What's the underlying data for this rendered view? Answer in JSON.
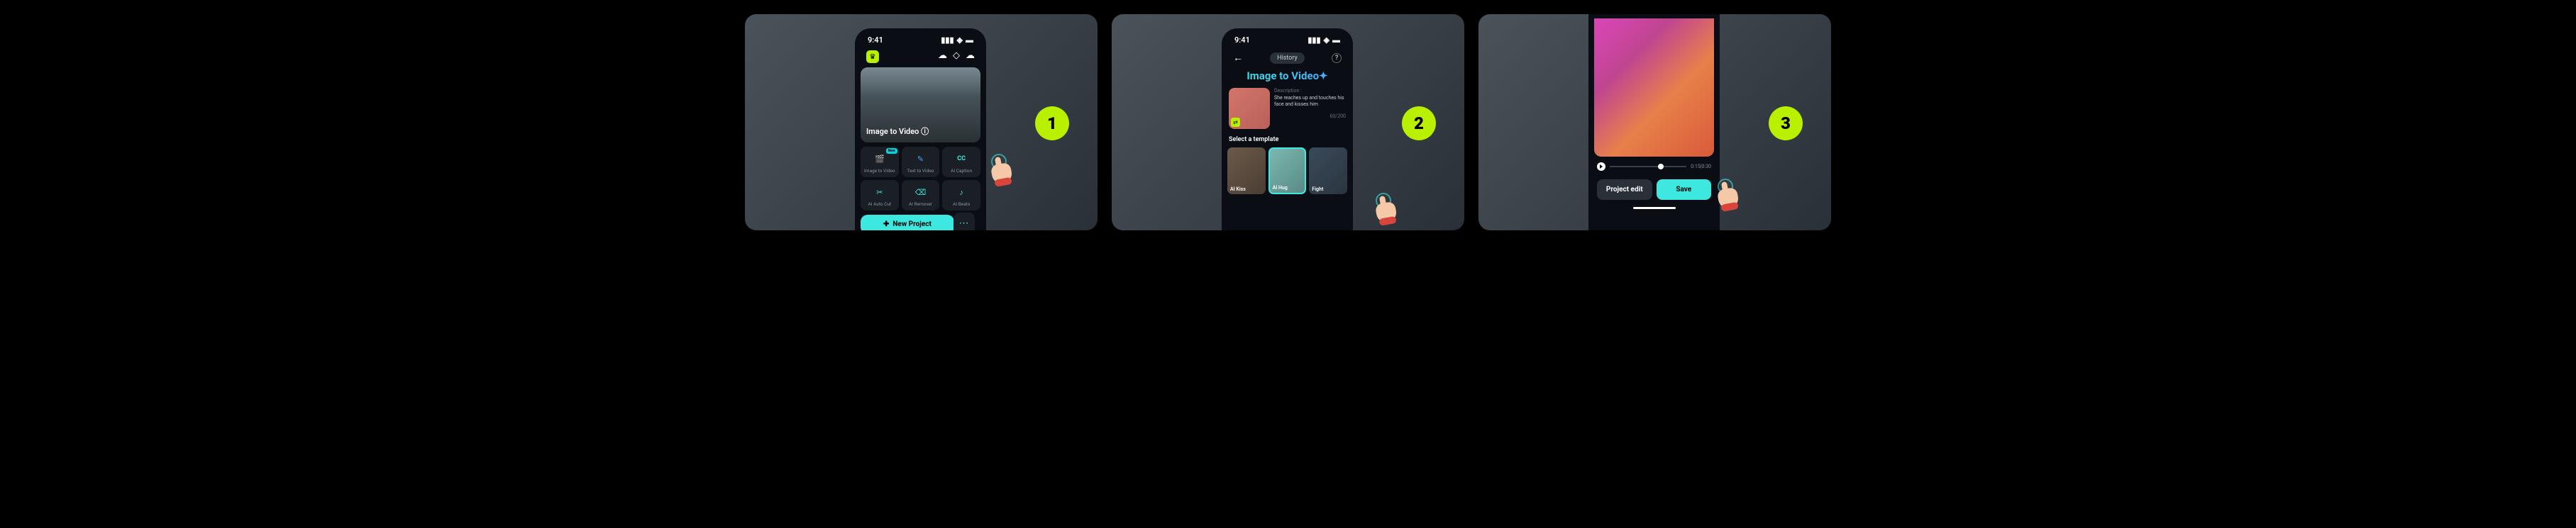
{
  "steps": [
    "1",
    "2",
    "3"
  ],
  "status_time": "9:41",
  "step1": {
    "hero_title": "Image  to Video ⓘ",
    "features": [
      {
        "label": "Image to Video",
        "icon": "🎬",
        "new": "New"
      },
      {
        "label": "Text to Video",
        "icon": "✎"
      },
      {
        "label": "AI Caption",
        "icon": "CC"
      },
      {
        "label": "AI Auto Cut",
        "icon": "✂"
      },
      {
        "label": "AI Remover",
        "icon": "⌫"
      },
      {
        "label": "AI Beats",
        "icon": "♪"
      }
    ],
    "new_project": "New Project",
    "more": "⋯"
  },
  "step2": {
    "back": "←",
    "history": "History",
    "help": "?",
    "page_title": "Image to Video✦",
    "desc_label": "Description :",
    "desc_text": "She reaches up and touches his face and kisses him",
    "char_count": "60/200",
    "select_template": "Select a template",
    "templates": [
      {
        "label": "AI Kiss"
      },
      {
        "label": "AI Hug"
      },
      {
        "label": "Fight"
      }
    ]
  },
  "step3": {
    "time_display": "0:15|0:30",
    "project_edit": "Project edit",
    "save": "Save"
  }
}
